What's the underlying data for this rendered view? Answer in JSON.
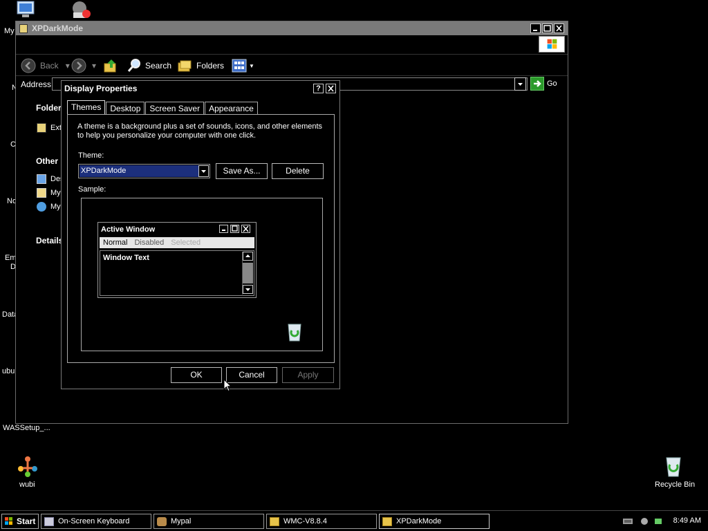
{
  "desktop": {
    "left_labels": [
      "My",
      "N",
      "C",
      "No",
      "Em",
      "D",
      "Data",
      "ubur"
    ],
    "was_setup_label": "WASSetup_...",
    "wubi_label": "wubi",
    "recycle_bin_label": "Recycle Bin"
  },
  "explorer": {
    "title": "XPDarkMode",
    "toolbar": {
      "back_label": "Back",
      "search_label": "Search",
      "folders_label": "Folders"
    },
    "address_label": "Address",
    "go_label": "Go",
    "sidebar": {
      "folder_heading": "Folder",
      "folder_item": "Ext",
      "other_heading": "Other l",
      "other_items": [
        "Des",
        "My",
        "My"
      ],
      "details_heading": "Details"
    }
  },
  "dialog": {
    "title": "Display Properties",
    "help_label": "?",
    "tabs": [
      "Themes",
      "Desktop",
      "Screen Saver",
      "Appearance"
    ],
    "description": "A theme is a background plus a set of sounds, icons, and other elements to help you personalize your computer with one click.",
    "theme_label": "Theme:",
    "theme_value": "XPDarkMode",
    "save_as_label": "Save As...",
    "delete_label": "Delete",
    "sample_label": "Sample:",
    "sample": {
      "active_window_title": "Active Window",
      "menu_normal": "Normal",
      "menu_disabled": "Disabled",
      "menu_selected": "Selected",
      "window_text": "Window Text"
    },
    "ok_label": "OK",
    "cancel_label": "Cancel",
    "apply_label": "Apply"
  },
  "taskbar": {
    "start_label": "Start",
    "tasks": [
      {
        "label": "On-Screen Keyboard",
        "icon": "keyboard-icon"
      },
      {
        "label": "Mypal",
        "icon": "mypal-icon"
      },
      {
        "label": "WMC-V8.8.4",
        "icon": "folder-icon"
      },
      {
        "label": "XPDarkMode",
        "icon": "folder-icon"
      }
    ],
    "clock": "8:49 AM"
  },
  "colors": {
    "selection": "#1c2f7c",
    "window_bg": "#000000",
    "explorer_titlebar": "#7a7a7a",
    "go_green": "#2b9a2b"
  }
}
